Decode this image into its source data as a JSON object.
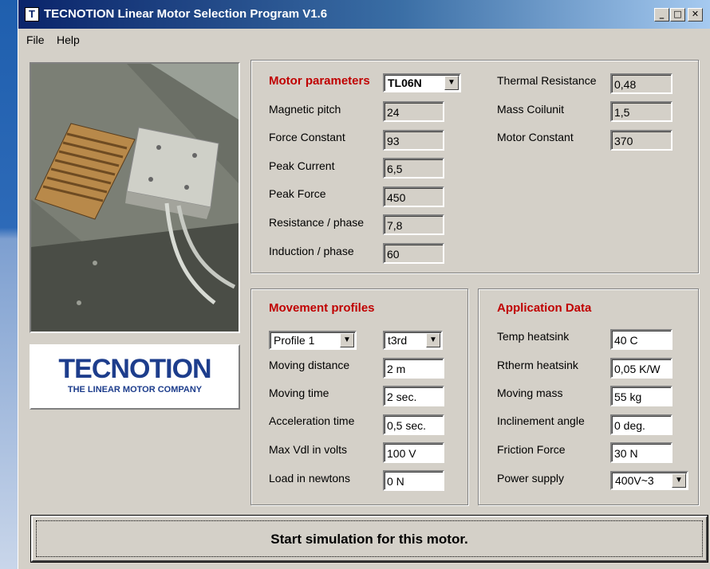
{
  "window": {
    "title": "TECNOTION Linear Motor Selection Program V1.6",
    "icon_letter": "T",
    "controls": {
      "minimize": "_",
      "maximize": "□",
      "close": "✕"
    }
  },
  "menu": {
    "items": [
      "File",
      "Help"
    ]
  },
  "logo": {
    "main": "TECNOTION",
    "sub": "THE LINEAR MOTOR COMPANY"
  },
  "motor_parameters": {
    "title": "Motor parameters",
    "motor_select": "TL06N",
    "left": [
      {
        "label": "Magnetic pitch",
        "value": "24"
      },
      {
        "label": "Force Constant",
        "value": "93"
      },
      {
        "label": "Peak Current",
        "value": "6,5"
      },
      {
        "label": "Peak Force",
        "value": "450"
      },
      {
        "label": "Resistance / phase",
        "value": "7,8"
      },
      {
        "label": "Induction / phase",
        "value": "60"
      }
    ],
    "right": [
      {
        "label": "Thermal Resistance",
        "value": "0,48"
      },
      {
        "label": "Mass Coilunit",
        "value": "1,5"
      },
      {
        "label": "Motor Constant",
        "value": "370"
      }
    ]
  },
  "movement_profiles": {
    "title": "Movement profiles",
    "profile_select": "Profile 1",
    "shape_select": "t3rd",
    "fields": [
      {
        "label": "Moving distance",
        "value": "2 m"
      },
      {
        "label": "Moving time",
        "value": "2 sec."
      },
      {
        "label": "Acceleration time",
        "value": "0,5 sec."
      },
      {
        "label": "Max Vdl in volts",
        "value": "100 V"
      },
      {
        "label": "Load in newtons",
        "value": "0 N"
      }
    ]
  },
  "application_data": {
    "title": "Application Data",
    "fields": [
      {
        "label": "Temp heatsink",
        "value": "40 C"
      },
      {
        "label": "Rtherm heatsink",
        "value": "0,05 K/W"
      },
      {
        "label": "Moving mass",
        "value": "55 kg"
      },
      {
        "label": "Inclinement angle",
        "value": "0 deg."
      },
      {
        "label": "Friction Force",
        "value": "30 N"
      }
    ],
    "power_supply_label": "Power supply",
    "power_supply_value": "400V~3"
  },
  "start_button": "Start simulation for this motor.",
  "icons": {
    "dropdown": "▼"
  }
}
